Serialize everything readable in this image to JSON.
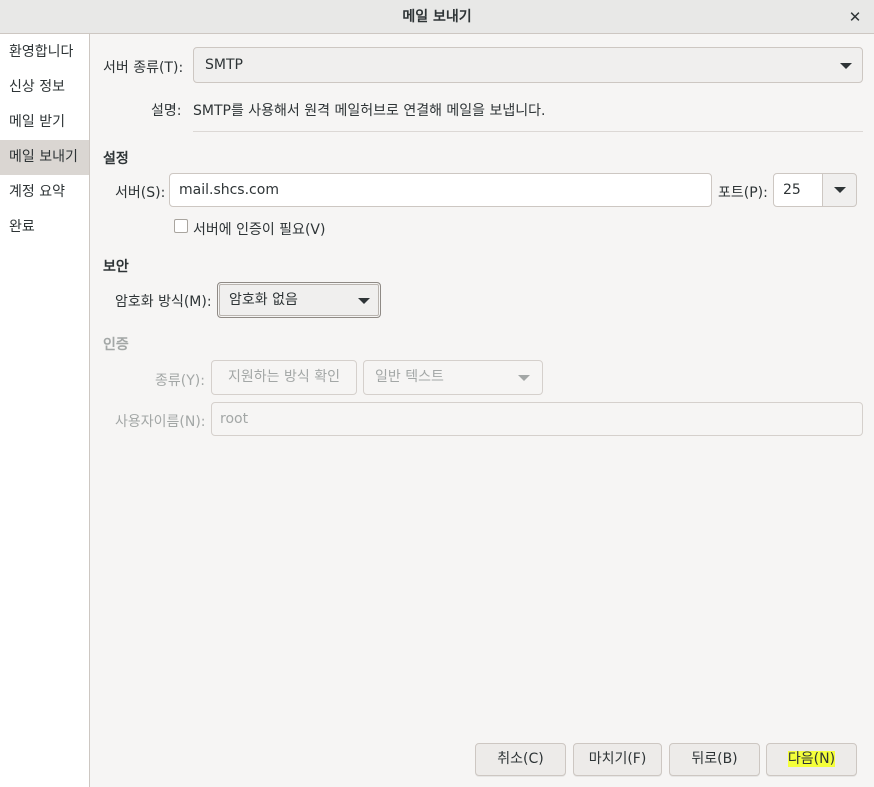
{
  "window": {
    "title": "메일 보내기",
    "close_glyph": "✕"
  },
  "sidebar": {
    "items": [
      {
        "label": "환영합니다"
      },
      {
        "label": "신상 정보"
      },
      {
        "label": "메일 받기"
      },
      {
        "label": "메일 보내기",
        "active": true
      },
      {
        "label": "계정 요약"
      },
      {
        "label": "완료"
      }
    ]
  },
  "server_type": {
    "label": "서버 종류(T):",
    "value": "SMTP",
    "description_label": "설명:",
    "description": "SMTP를 사용해서 원격 메일허브로 연결해 메일을 보냅니다."
  },
  "settings": {
    "heading": "설정",
    "server_label": "서버(S):",
    "server_value": "mail.shcs.com",
    "port_label": "포트(P):",
    "port_value": "25",
    "auth_required_label": "서버에 인증이 필요(V)",
    "auth_required_checked": false
  },
  "security": {
    "heading": "보안",
    "encryption_label": "암호화 방식(M):",
    "encryption_value": "암호화 없음"
  },
  "auth": {
    "heading": "인증",
    "type_label": "종류(Y):",
    "check_button": "지원하는 방식 확인",
    "type_value": "일반 텍스트",
    "username_label": "사용자이름(N):",
    "username_value": "root"
  },
  "buttons": {
    "cancel": "취소(C)",
    "finish": "마치기(F)",
    "back": "뒤로(B)",
    "next": "다음(N)"
  },
  "colors": {
    "highlight": "#f4ff3a",
    "active_sidebar": "#dad6d2",
    "background": "#f6f5f4"
  },
  "icons": {
    "close": "close-icon",
    "dropdown": "chevron-down-icon"
  }
}
